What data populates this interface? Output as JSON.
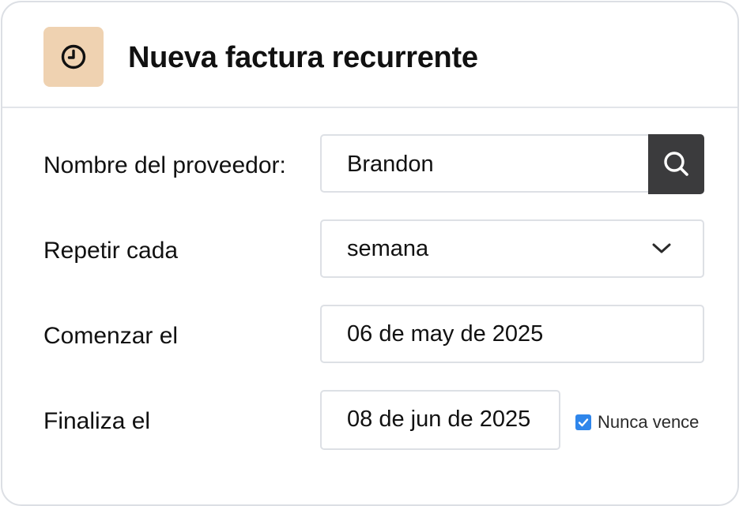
{
  "header": {
    "title": "Nueva factura recurrente",
    "icon": "clock-icon",
    "icon_bg_color": "#efd2b1"
  },
  "form": {
    "vendor": {
      "label": "Nombre del proveedor:",
      "value": "Brandon",
      "search_icon": "search-icon"
    },
    "repeat": {
      "label": "Repetir cada",
      "selected": "semana",
      "dropdown_icon": "chevron-down-icon"
    },
    "start": {
      "label": "Comenzar el",
      "value": "06 de may de 2025"
    },
    "end": {
      "label": "Finaliza el",
      "value": "08 de jun de 2025",
      "never_expires": {
        "label": "Nunca vence",
        "checked": true,
        "color": "#2f86eb"
      }
    }
  },
  "colors": {
    "search_button_bg": "#3b3b3d",
    "border": "#dde0e5"
  }
}
